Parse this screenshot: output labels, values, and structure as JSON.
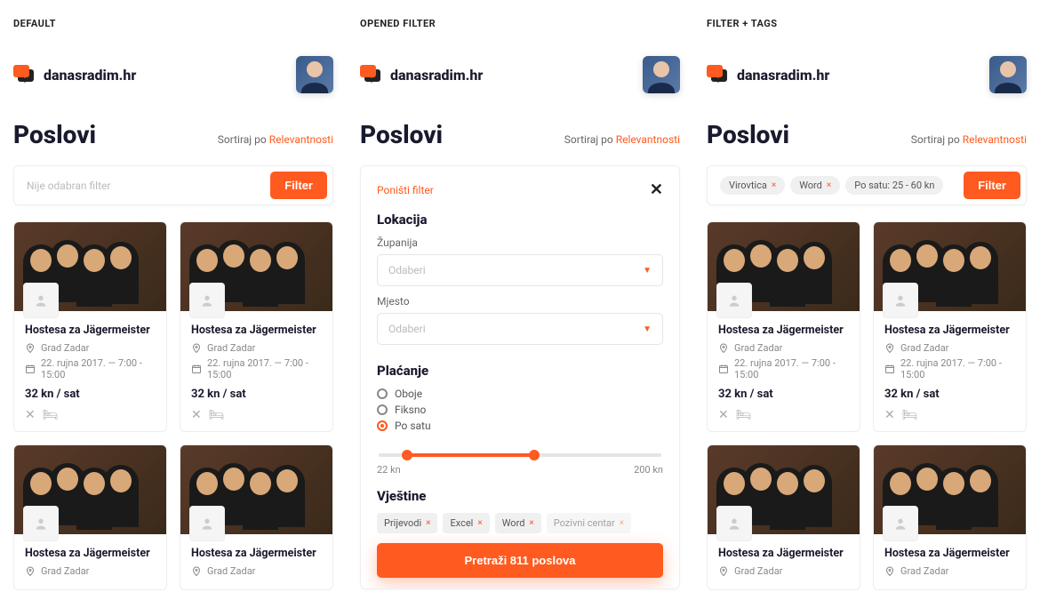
{
  "states": {
    "default": "DEFAULT",
    "opened": "OPENED FILTER",
    "tags": "FILTER + TAGS"
  },
  "brand": "danasradim.hr",
  "page_title": "Poslovi",
  "sort_label": "Sortiraj po",
  "sort_value": "Relevantnosti",
  "filter_placeholder": "Nije odabran filter",
  "filter_button": "Filter",
  "filter_panel": {
    "reset": "Poništi filter",
    "location_heading": "Lokacija",
    "county_label": "Županija",
    "place_label": "Mjesto",
    "select_placeholder": "Odaberi",
    "payment_heading": "Plaćanje",
    "payment_options": [
      "Oboje",
      "Fiksno",
      "Po satu"
    ],
    "payment_selected": "Po satu",
    "slider_min": "22 kn",
    "slider_max": "200 kn",
    "skills_heading": "Vještine",
    "skills": [
      "Prijevodi",
      "Excel",
      "Word",
      "Pozivni centar"
    ],
    "search_button": "Pretraži 811 poslova"
  },
  "applied_filters": {
    "location": "Virovtica",
    "skill": "Word",
    "rate": "Po satu: 25 - 60 kn"
  },
  "job": {
    "title": "Hostesa za Jägermeister",
    "location": "Grad Zadar",
    "date": "22. rujna 2017. — 7:00 - 15:00",
    "rate": "32 kn / sat"
  }
}
